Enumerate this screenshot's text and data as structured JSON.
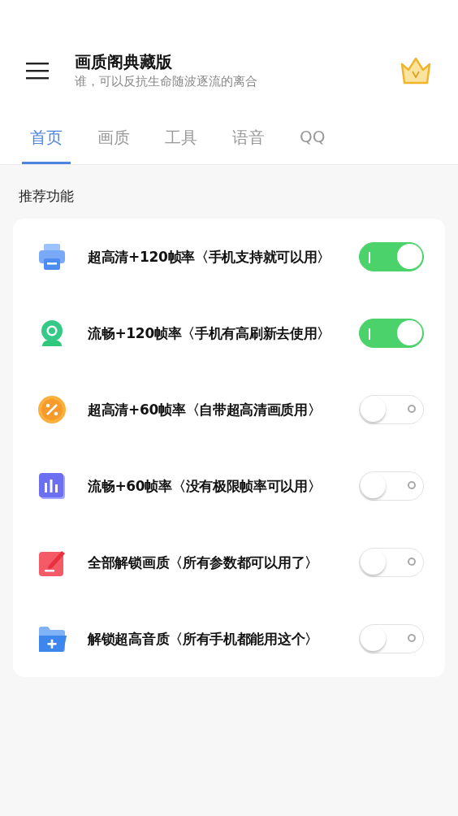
{
  "header": {
    "title": "画质阁典藏版",
    "subtitle": "谁，可以反抗生命随波逐流的离合"
  },
  "tabs": [
    {
      "label": "首页",
      "selected": true
    },
    {
      "label": "画质",
      "selected": false
    },
    {
      "label": "工具",
      "selected": false
    },
    {
      "label": "语音",
      "selected": false
    },
    {
      "label": "QQ",
      "selected": false
    }
  ],
  "section_title": "推荐功能",
  "features": [
    {
      "label": "超高清+120帧率〈手机支持就可以用〉",
      "on": true
    },
    {
      "label": "流畅+120帧率〈手机有高刷新去使用〉",
      "on": true
    },
    {
      "label": "超高清+60帧率〈自带超高清画质用〉",
      "on": false
    },
    {
      "label": "流畅+60帧率〈没有极限帧率可以用〉",
      "on": false
    },
    {
      "label": "全部解锁画质〈所有参数都可以用了〉",
      "on": false
    },
    {
      "label": "解锁超高音质〈所有手机都能用这个〉",
      "on": false
    }
  ]
}
